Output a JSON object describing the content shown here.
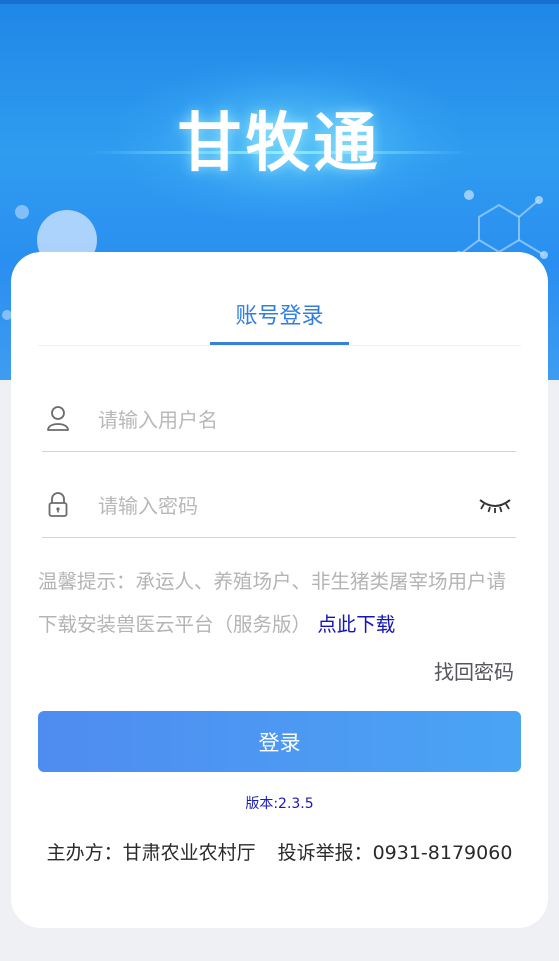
{
  "app": {
    "title": "甘牧通"
  },
  "tabs": [
    {
      "label": "账号登录",
      "active": true
    }
  ],
  "form": {
    "username_placeholder": "请输入用户名",
    "password_placeholder": "请输入密码"
  },
  "tip": {
    "text": "温馨提示：承运人、养殖场户、非生猪类屠宰场用户请下载安装兽医云平台（服务版）",
    "link_label": "点此下载"
  },
  "forgot_label": "找回密码",
  "login_label": "登录",
  "version_text": "版本:2.3.5",
  "footer": {
    "sponsor": "主办方：甘肃农业农村厅",
    "report": "投诉举报：0931-8179060"
  },
  "colors": {
    "accent": "#3a7fd8",
    "button_start": "#4f8cf0",
    "button_end": "#4aa4f4",
    "link": "#1414b8"
  },
  "icons": [
    "user-icon",
    "lock-icon",
    "eye-closed-icon"
  ]
}
